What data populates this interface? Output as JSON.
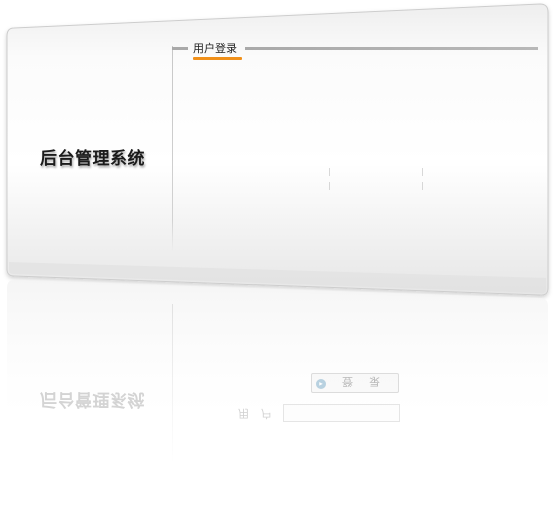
{
  "app": {
    "system_title": "后台管理系统"
  },
  "login": {
    "section_title": "用户登录"
  },
  "reflection": {
    "system_title": "后台管理系统",
    "button_label": "登录",
    "field_label": "用户"
  },
  "colors": {
    "accent": "#f0901a",
    "panel_top": "#f7f7f7",
    "panel_bottom": "#e2e2e2",
    "border": "#cfcfcf",
    "divider": "#c8c8c8"
  }
}
